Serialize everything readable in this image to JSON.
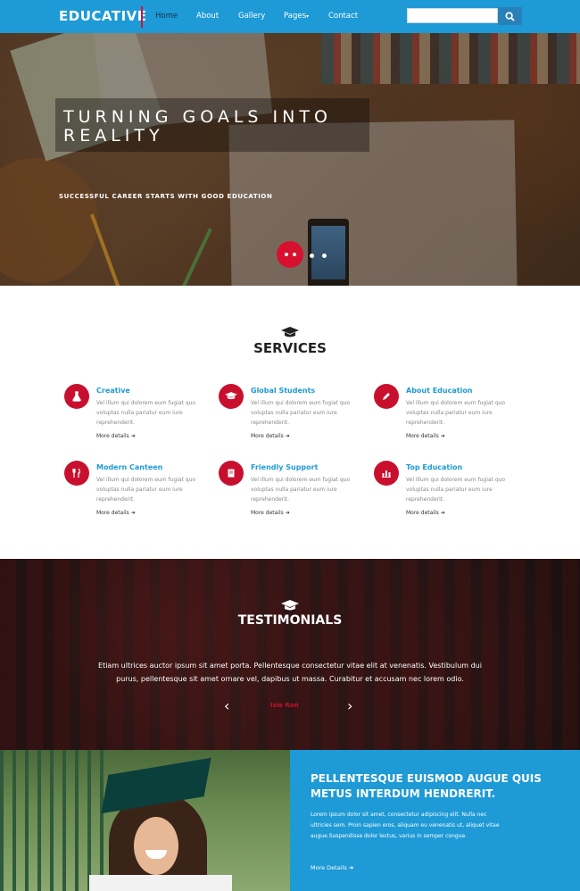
{
  "nav": {
    "logo": "EDUCATIVE",
    "links": [
      "Home",
      "About",
      "Gallery",
      "Pages",
      "Contact"
    ],
    "search_placeholder": ""
  },
  "hero": {
    "title": "TURNING GOALS INTO REALITY",
    "subtitle": "SUCCESSFUL CAREER STARTS WITH GOOD EDUCATION"
  },
  "services": {
    "title": "SERVICES",
    "items": [
      {
        "title": "Creative",
        "desc": "Vel illum qui dolorem eum fugiat quo voluptas nulla pariatur eum iure reprehenderit.",
        "more": "More details"
      },
      {
        "title": "Global Students",
        "desc": "Vel illum qui dolorem eum fugiat quo voluptas nulla pariatur eum iure reprehenderit.",
        "more": "More details"
      },
      {
        "title": "About Education",
        "desc": "Vel illum qui dolorem eum fugiat quo voluptas nulla pariatur eum iure reprehenderit.",
        "more": "More details"
      },
      {
        "title": "Modern Canteen",
        "desc": "Vel illum qui dolorem eum fugiat quo voluptas nulla pariatur eum iure reprehenderit.",
        "more": "More details"
      },
      {
        "title": "Friendly Support",
        "desc": "Vel illum qui dolorem eum fugiat quo voluptas nulla pariatur eum iure reprehenderit.",
        "more": "More details"
      },
      {
        "title": "Top Education",
        "desc": "Vel illum qui dolorem eum fugiat quo voluptas nulla pariatur eum iure reprehenderit.",
        "more": "More details"
      }
    ]
  },
  "testimonials": {
    "title": "TESTIMONIALS",
    "quote": "Etiam ultrices auctor ipsum sit amet porta. Pellentesque consectetur vitae elit at venenatis. Vestibulum dui purus, pellentesque sit amet ornare vel, dapibus ut massa. Curabitur et accusam nec lorem odio.",
    "author": "Isie Ron"
  },
  "feature": {
    "title": "PELLENTESQUE EUISMOD AUGUE QUIS METUS INTERDUM HENDRERIT.",
    "text": "Lorem ipsum dolor sit amet, consectetur adipiscing elit. Nulla nec ultricies sem. Proin sapien eros, aliquam eu venenatis ut, aliquet vitae augue.Suspendisse dolor lectus, varius in semper congue.",
    "more": "More Details"
  },
  "colors": {
    "primary": "#1e9ad6",
    "accent": "#c8102e"
  }
}
